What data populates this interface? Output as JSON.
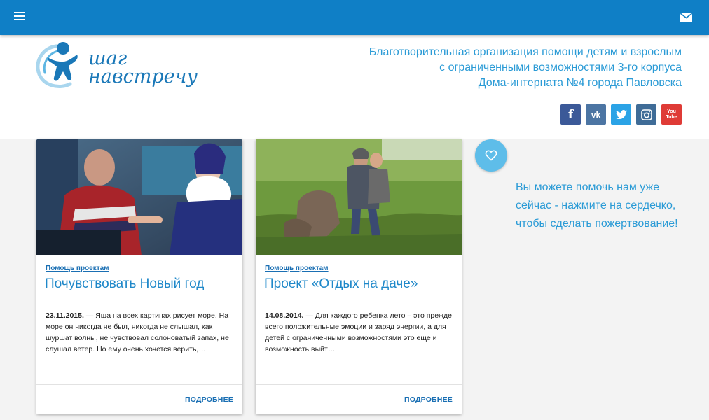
{
  "topbar": {
    "menu_icon": "hamburger-menu-icon",
    "mail_icon": "envelope-icon",
    "accent": "#0f7fc6"
  },
  "logo": {
    "line1": "шаг",
    "line2": "навстречу"
  },
  "org_description": {
    "line1": "Благотворительная организация помощи детям и взрослым",
    "line2": "с ограниченными возможностями 3-го корпуса",
    "line3": "Дома-интерната №4 города Павловска"
  },
  "social": [
    {
      "name": "facebook",
      "glyph": "f",
      "color": "#3b5998"
    },
    {
      "name": "vkontakte",
      "glyph": "vk",
      "color": "#4c75a3"
    },
    {
      "name": "twitter",
      "glyph": "twitter-bird",
      "color": "#2ba3e6"
    },
    {
      "name": "instagram",
      "glyph": "camera",
      "color": "#3f6c97"
    },
    {
      "name": "youtube",
      "glyph": "You Tube",
      "color": "#df3b36"
    }
  ],
  "cards": [
    {
      "category": "Помощь проектам",
      "title": "Почувствовать Новый год",
      "date": "23.11.2015.",
      "excerpt": " — Яша на всех картинах рисует море. На море он никогда не был, никогда не слышал, как шуршат волны, не чувствовал солоноватый запах, не слушал ветер. Но ему очень хочется верить,…",
      "more_label": "ПОДРОБНЕЕ"
    },
    {
      "category": "Помощь проектам",
      "title": "Проект «Отдых на даче»",
      "date": "14.08.2014.",
      "excerpt": " — Для каждого ребенка лето – это прежде всего положительные эмоции и заряд энергии, а для детей с ограниченными возможностями это еще и возможность выйт…",
      "more_label": "ПОДРОБНЕЕ"
    }
  ],
  "donate": {
    "icon": "heart-icon",
    "text": "Вы можете помочь нам уже сейчас - нажмите на сердечко, чтобы сделать пожертвование!"
  }
}
